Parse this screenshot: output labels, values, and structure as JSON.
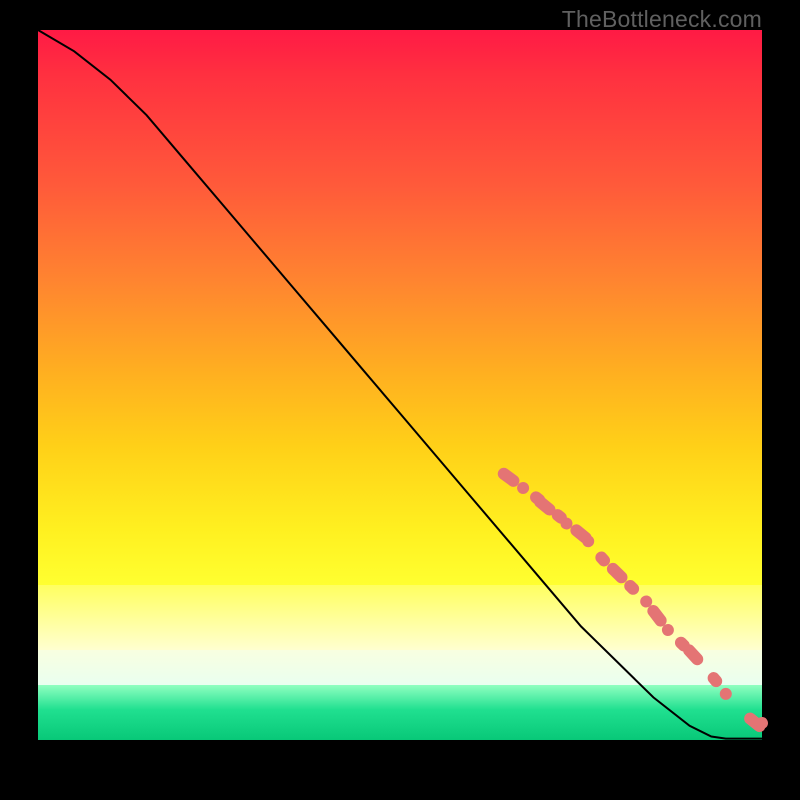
{
  "watermark": "TheBottleneck.com",
  "chart_data": {
    "type": "line",
    "title": "",
    "xlabel": "",
    "ylabel": "",
    "x": [
      0,
      5,
      10,
      15,
      20,
      25,
      30,
      35,
      40,
      45,
      50,
      55,
      60,
      65,
      70,
      75,
      80,
      85,
      90,
      93,
      95,
      100
    ],
    "values": [
      100,
      97,
      93,
      88,
      82,
      76,
      70,
      64,
      58,
      52,
      46,
      40,
      34,
      28,
      22,
      16,
      11,
      6,
      2,
      0.5,
      0.2,
      0.2
    ],
    "xlim": [
      0,
      100
    ],
    "ylim": [
      0,
      100
    ],
    "marker_clusters_x": [
      65,
      67,
      69,
      70,
      72,
      73,
      75,
      76,
      78,
      80,
      82,
      84,
      85.5,
      87,
      89,
      90.5,
      93.5,
      95,
      99,
      100
    ],
    "marker_clusters_y": [
      37,
      35.5,
      34,
      33,
      31.5,
      30.5,
      29,
      28,
      25.5,
      23.5,
      21.5,
      19.5,
      17.5,
      15.5,
      13.5,
      12,
      8.5,
      6.5,
      2.5,
      2.4
    ],
    "annotations": []
  },
  "colors": {
    "background_black": "#000000",
    "gradient_top": "#ff1a45",
    "gradient_mid": "#ffd018",
    "gradient_green": "#08c878",
    "line": "#000000",
    "marker_fill": "#e47474",
    "watermark": "#606060"
  }
}
